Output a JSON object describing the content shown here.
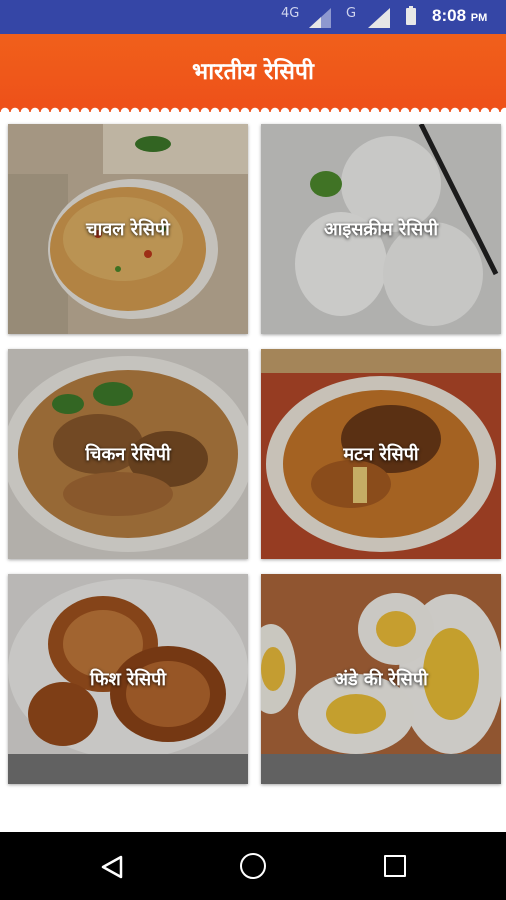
{
  "status_bar": {
    "network_1": "4G",
    "network_2": "G",
    "time": "8:08",
    "ampm": "PM"
  },
  "app_bar": {
    "title": "भारतीय रेसिपी"
  },
  "categories": [
    {
      "label": "चावल रेसिपी"
    },
    {
      "label": "आइसक्रीम रेसिपी"
    },
    {
      "label": "चिकन रेसिपी"
    },
    {
      "label": "मटन रेसिपी"
    },
    {
      "label": "फिश रेसिपी"
    },
    {
      "label": "अंडे की रेसिपी"
    }
  ],
  "nav_bar": {
    "back_icon": "back-triangle-icon",
    "home_icon": "home-circle-icon",
    "recents_icon": "recents-square-icon"
  },
  "colors": {
    "status_bar": "#3546a6",
    "app_bar": "#ef5a1a",
    "nav_bar": "#000000"
  }
}
